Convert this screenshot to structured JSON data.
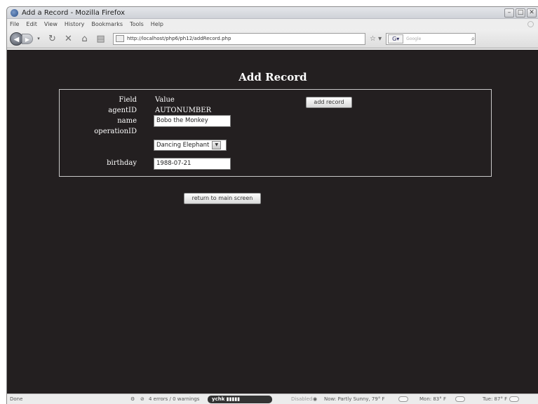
{
  "window": {
    "title": "Add a Record - Mozilla Firefox"
  },
  "menu": [
    "File",
    "Edit",
    "View",
    "History",
    "Bookmarks",
    "Tools",
    "Help"
  ],
  "nav": {
    "url": "http://localhost/php6/ph12/addRecord.php",
    "search_placeholder": "Google"
  },
  "page": {
    "title": "Add Record",
    "header_field": "Field",
    "header_value": "Value",
    "agentID_label": "agentID",
    "agentID_value": "AUTONUMBER",
    "name_label": "name",
    "name_value": "Bobo the Monkey",
    "operationID_label": "operationID",
    "operationID_value": "Dancing Elephant",
    "birthday_label": "birthday",
    "birthday_value": "1988-07-21",
    "add_button": "add record",
    "return_button": "return to main screen"
  },
  "status": {
    "done": "Done",
    "errors": "4 errors / 0 warnings",
    "disabled": "Disabled",
    "now": "Now: Partly Sunny, 79° F",
    "mon": "Mon: 83° F",
    "tue": "Tue: 87° F"
  },
  "icons": [
    "firefox-icon",
    "back-arrow-icon",
    "forward-arrow-icon",
    "reload-icon",
    "stop-icon",
    "home-icon",
    "bookmark-icon",
    "page-icon",
    "star-icon",
    "search-icon"
  ]
}
